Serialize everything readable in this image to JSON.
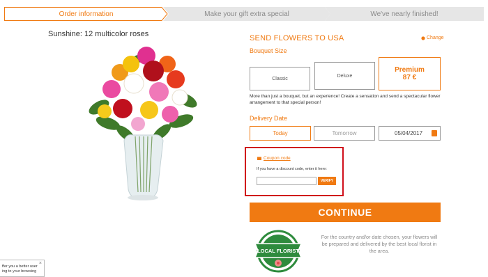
{
  "steps": [
    {
      "label": "Order information",
      "state": "active"
    },
    {
      "label": "Make your gift extra special",
      "state": "inactive"
    },
    {
      "label": "We've nearly finished!",
      "state": "inactive"
    }
  ],
  "product": {
    "title": "Sunshine: 12 multicolor roses"
  },
  "delivery_country": {
    "title": "SEND FLOWERS TO USA",
    "change_label": "Change"
  },
  "bouquet_size": {
    "label": "Bouquet Size",
    "options": [
      {
        "name": "Classic"
      },
      {
        "name": "Deluxe"
      },
      {
        "name": "Premium",
        "price": "87 €",
        "selected": true
      }
    ],
    "description": "More than just a bouquet, but an experience! Create a sensation and send a spectacular flower arrangement to that special person!"
  },
  "delivery_date": {
    "label": "Delivery Date",
    "today": "Today",
    "tomorrow": "Tomorrow",
    "date_value": "05/04/2017"
  },
  "coupon": {
    "link_label": "Coupon code",
    "hint": "If you have a discount code, enter it here:",
    "input_value": "",
    "verify_label": "VERIFY"
  },
  "continue_label": "CONTINUE",
  "local_florist": {
    "badge_text": "LOCAL FLORIST",
    "description": "For the country and/or date chosen, your flowers will be prepared and delivered by the best local florist in the area."
  },
  "cookie_notice": {
    "line1": "ffer you a better user",
    "line2": "ing to your browsing",
    "close": "×"
  },
  "colors": {
    "accent": "#f07a12",
    "highlight_border": "#d0101b",
    "badge_green": "#2e8b3d"
  }
}
